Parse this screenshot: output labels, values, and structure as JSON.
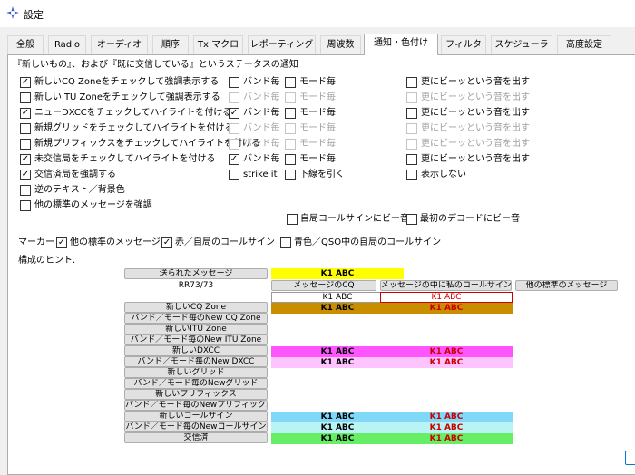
{
  "window": {
    "title": "設定"
  },
  "tabs": [
    {
      "label": "全般"
    },
    {
      "label": "Radio"
    },
    {
      "label": "オーディオ"
    },
    {
      "label": "順序"
    },
    {
      "label": "Tx マクロ"
    },
    {
      "label": "レポーティング"
    },
    {
      "label": "周波数"
    },
    {
      "label": "通知・色付け",
      "active": true
    },
    {
      "label": "フィルタ"
    },
    {
      "label": "スケジューラ"
    },
    {
      "label": "高度設定"
    }
  ],
  "section_title": "『新しいもの』、および『既に交信している』というステータスの通知",
  "rows": [
    {
      "label": "新しいCQ Zoneをチェックして強調表示する",
      "checked": true,
      "band": "バンド毎",
      "band_checked": false,
      "band_enabled": true,
      "mode": "モード毎",
      "mode_checked": false,
      "mode_enabled": true,
      "beep": "更にビーッという音を出す",
      "beep_checked": false,
      "beep_enabled": true
    },
    {
      "label": "新しいITU Zoneをチェックして強調表示する",
      "checked": false,
      "band": "バンド毎",
      "band_checked": false,
      "band_enabled": false,
      "mode": "モード毎",
      "mode_checked": false,
      "mode_enabled": false,
      "beep": "更にビーッという音を出す",
      "beep_checked": false,
      "beep_enabled": false
    },
    {
      "label": "ニューDXCCをチェックしてハイライトを付ける",
      "checked": true,
      "band": "バンド毎",
      "band_checked": true,
      "band_enabled": true,
      "mode": "モード毎",
      "mode_checked": false,
      "mode_enabled": true,
      "beep": "更にビーッという音を出す",
      "beep_checked": false,
      "beep_enabled": true
    },
    {
      "label": "新規グリッドをチェックしてハイライトを付ける",
      "checked": false,
      "band": "バンド毎",
      "band_checked": false,
      "band_enabled": false,
      "mode": "モード毎",
      "mode_checked": false,
      "mode_enabled": false,
      "beep": "更にビーッという音を出す",
      "beep_checked": false,
      "beep_enabled": false
    },
    {
      "label": "新規プリフィックスをチェックしてハイライトを付ける",
      "checked": false,
      "band": "バンド毎",
      "band_checked": false,
      "band_enabled": false,
      "mode": "モード毎",
      "mode_checked": false,
      "mode_enabled": false,
      "beep": "更にビーッという音を出す",
      "beep_checked": false,
      "beep_enabled": false
    },
    {
      "label": "未交信局をチェックしてハイライトを付ける",
      "checked": true,
      "band": "バンド毎",
      "band_checked": true,
      "band_enabled": true,
      "mode": "モード毎",
      "mode_checked": false,
      "mode_enabled": true,
      "beep": "更にビーッという音を出す",
      "beep_checked": false,
      "beep_enabled": true
    },
    {
      "label": "交信済局を強調する",
      "checked": true,
      "band": "strike it",
      "band_checked": false,
      "band_enabled": true,
      "mode": "下線を引く",
      "mode_checked": false,
      "mode_enabled": true,
      "beep": "表示しない",
      "beep_checked": false,
      "beep_enabled": true
    },
    {
      "label": "逆のテキスト／背景色",
      "checked": false
    },
    {
      "label": "他の標準のメッセージを強調",
      "checked": false
    }
  ],
  "own_call_beep": "自局コールサインにビー音",
  "first_decode_beep": "最初のデコードにビー音",
  "marker": {
    "label": "マーカー",
    "items": [
      {
        "label": "他の標準のメッセージ",
        "checked": true
      },
      {
        "label": "赤／自局のコールサイン",
        "checked": true
      },
      {
        "label": "青色／QSO中の自局のコールサイン",
        "checked": false
      }
    ]
  },
  "hints_title": "構成のヒント.",
  "hints": {
    "sent_button": "送られたメッセージ",
    "rr_text": "RR73/73",
    "cq_button": "メッセージのCQ",
    "mycall_button": "メッセージの中に私のコールサイン",
    "other_button": "他の標準のメッセージ",
    "sample": "K1 ABC",
    "buttons": [
      "新しいCQ Zone",
      "バンド／モード毎のNew CQ Zone",
      "新しいITU Zone",
      "バンド／モード毎のNew ITU Zone",
      "新しいDXCC",
      "バンド／モード毎のNew DXCC",
      "新しいグリッド",
      "バンド／モード毎のNewグリッド",
      "新しいプリフィックス",
      "バンド／モード毎のNewプリフィックス",
      "新しいコールサイン",
      "バンド／モード毎のNewコールサイン",
      "交信済"
    ]
  },
  "colors": {
    "sent_bg": "#ffff00",
    "cq_zone_bg": "#c98e00",
    "dxcc_bg": "#ff55ff",
    "dxcc_band_bg": "#ffc4ff",
    "call_bg": "#80d8f8",
    "call_band_bg": "#b8f4f4",
    "worked_bg": "#66ee66",
    "red_text": "#cc0000"
  }
}
